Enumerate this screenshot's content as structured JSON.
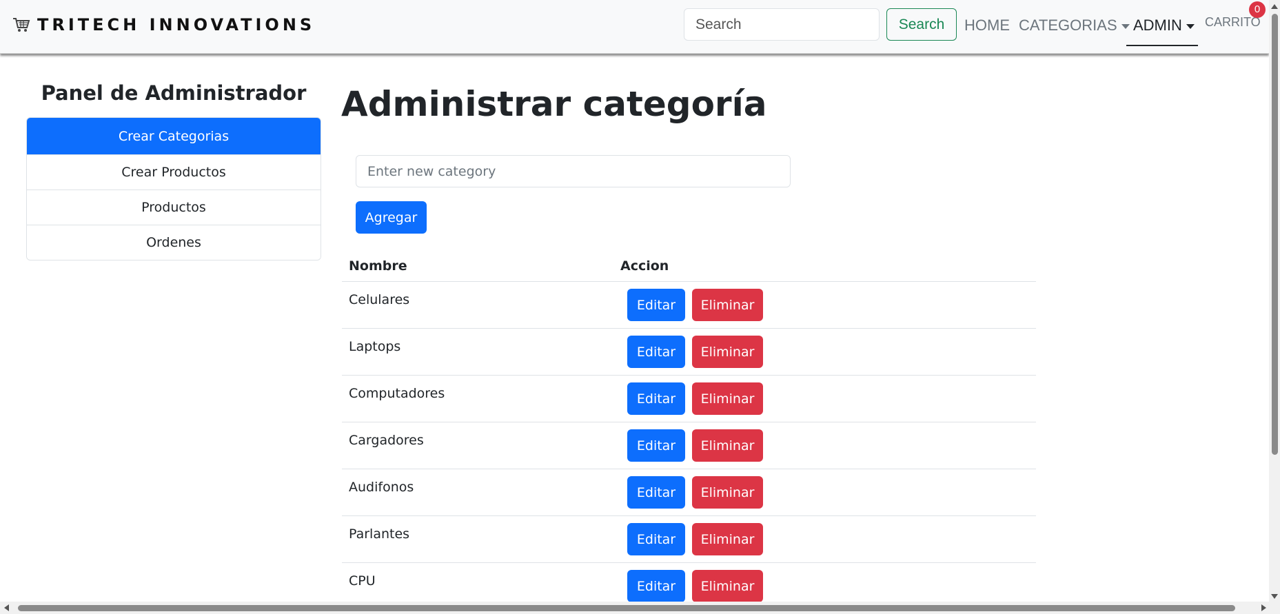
{
  "navbar": {
    "brand": "TRITECH INNOVATIONS",
    "brand_icon": "shopping-cart-icon",
    "search_placeholder": "Search",
    "search_button": "Search",
    "links": {
      "home": "HOME",
      "categories": "CATEGORIAS",
      "admin": "ADMIN",
      "cart": "CARRITO"
    },
    "cart_count": "0"
  },
  "sidebar": {
    "title": "Panel de Administrador",
    "items": [
      {
        "label": "Crear Categorias",
        "active": true
      },
      {
        "label": "Crear Productos",
        "active": false
      },
      {
        "label": "Productos",
        "active": false
      },
      {
        "label": "Ordenes",
        "active": false
      }
    ]
  },
  "main": {
    "title": "Administrar categoría",
    "input_placeholder": "Enter new category",
    "add_button": "Agregar",
    "table": {
      "headers": {
        "name": "Nombre",
        "action": "Accion"
      },
      "edit_label": "Editar",
      "delete_label": "Eliminar",
      "rows": [
        "Celulares",
        "Laptops",
        "Computadores",
        "Cargadores",
        "Audifonos",
        "Parlantes",
        "CPU"
      ]
    }
  },
  "colors": {
    "primary": "#0d6efd",
    "danger": "#dc3545",
    "success": "#198754",
    "navbar_bg": "#f8f9fa"
  }
}
